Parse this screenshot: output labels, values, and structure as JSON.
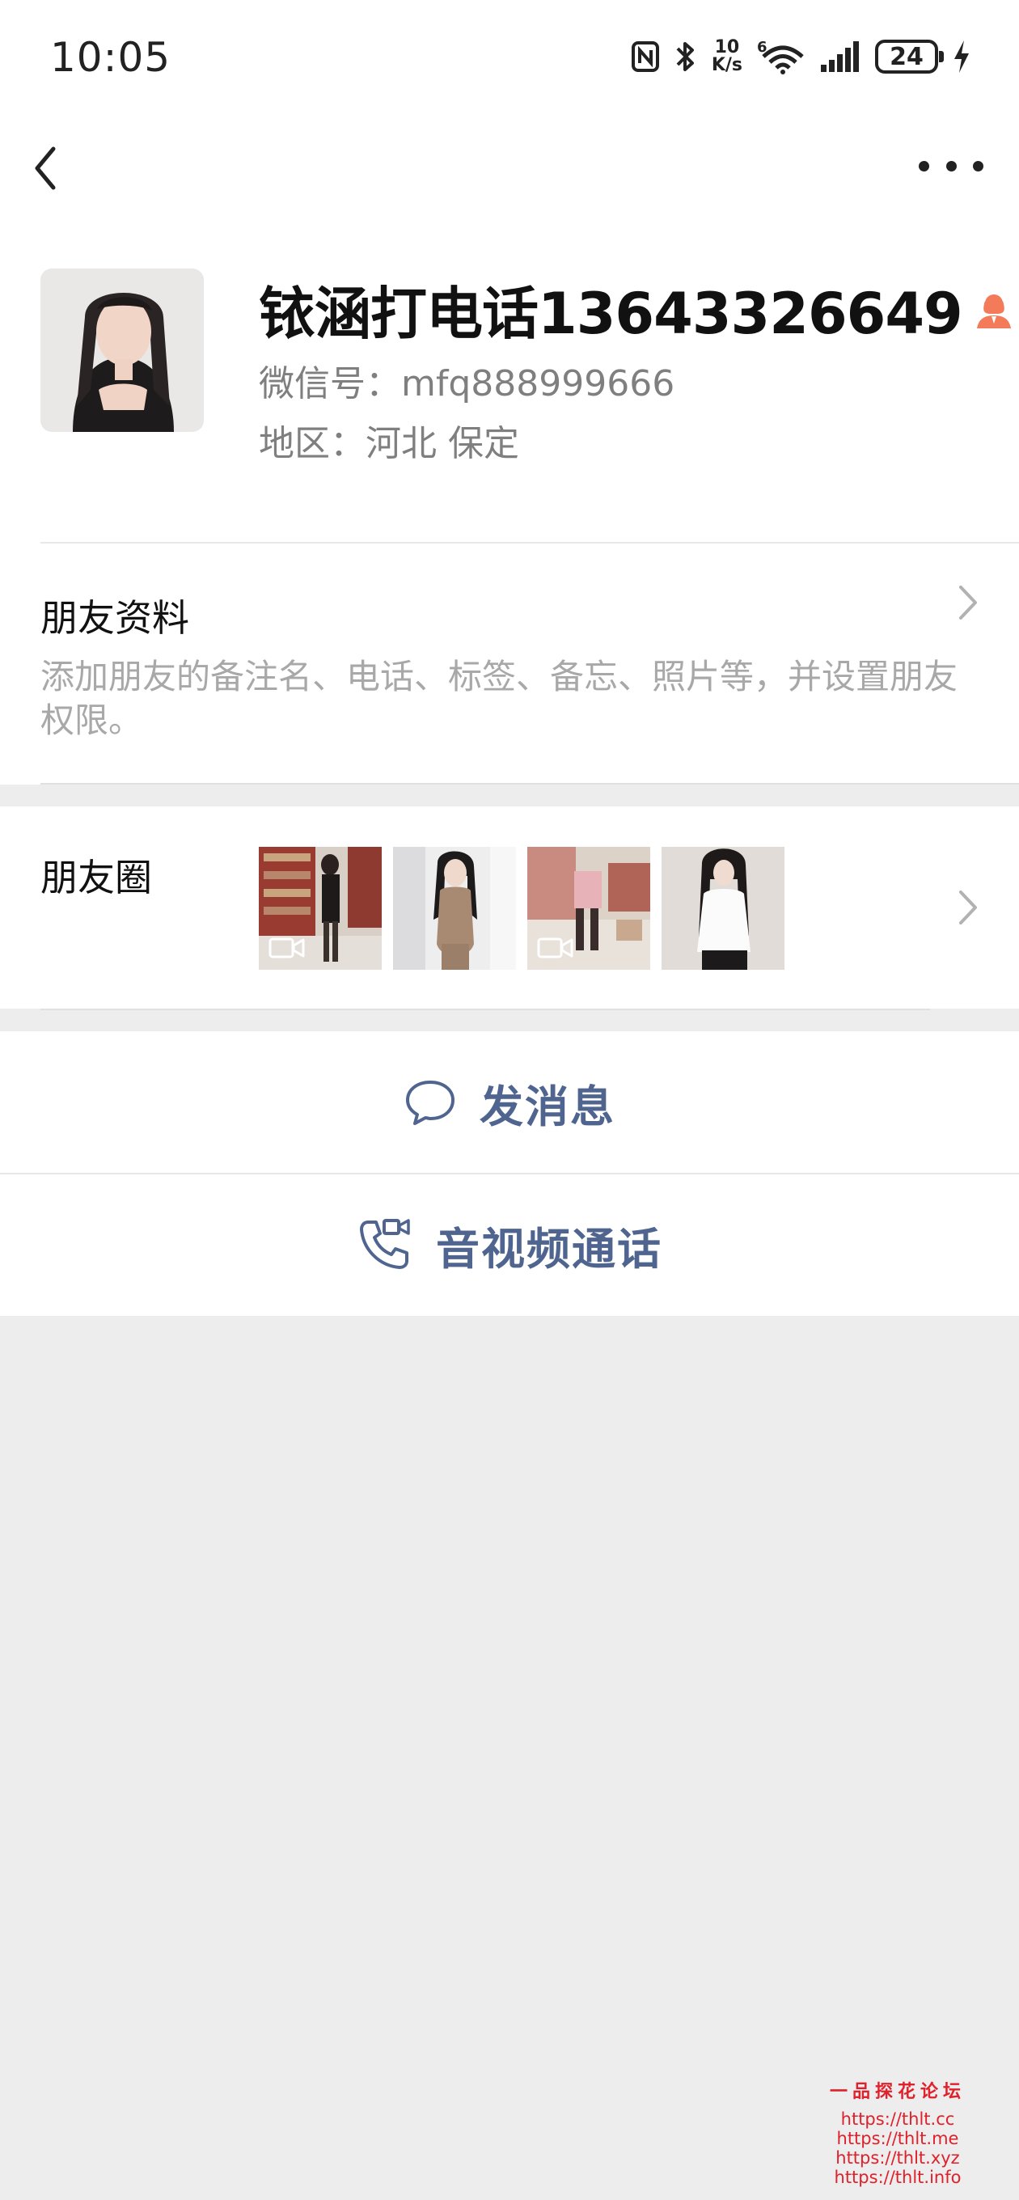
{
  "status_bar": {
    "time": "10:05",
    "net_speed_value": "10",
    "net_speed_unit": "K/s",
    "wifi_badge": "6",
    "battery": "24"
  },
  "profile": {
    "nickname": "铱涵打电话13643326649",
    "wechat_id": "微信号：mfq888999666",
    "region": "地区：河北  保定",
    "gender_color": "#f37b5a"
  },
  "friend_info": {
    "title": "朋友资料",
    "description": "添加朋友的备注名、电话、标签、备忘、照片等，并设置朋友权限。"
  },
  "moments": {
    "title": "朋友圈",
    "thumbnails": [
      {
        "icon": "video-icon",
        "is_video": true
      },
      {
        "icon": "photo-icon",
        "is_video": false
      },
      {
        "icon": "video-icon",
        "is_video": true
      },
      {
        "icon": "photo-icon",
        "is_video": false
      }
    ]
  },
  "actions": {
    "send_message": "发消息",
    "av_call": "音视频通话",
    "accent_color": "#4f6590"
  },
  "watermark": {
    "title": "一品探花论坛",
    "links": [
      "https://thlt.cc",
      "https://thlt.me",
      "https://thlt.xyz",
      "https://thlt.info"
    ]
  }
}
